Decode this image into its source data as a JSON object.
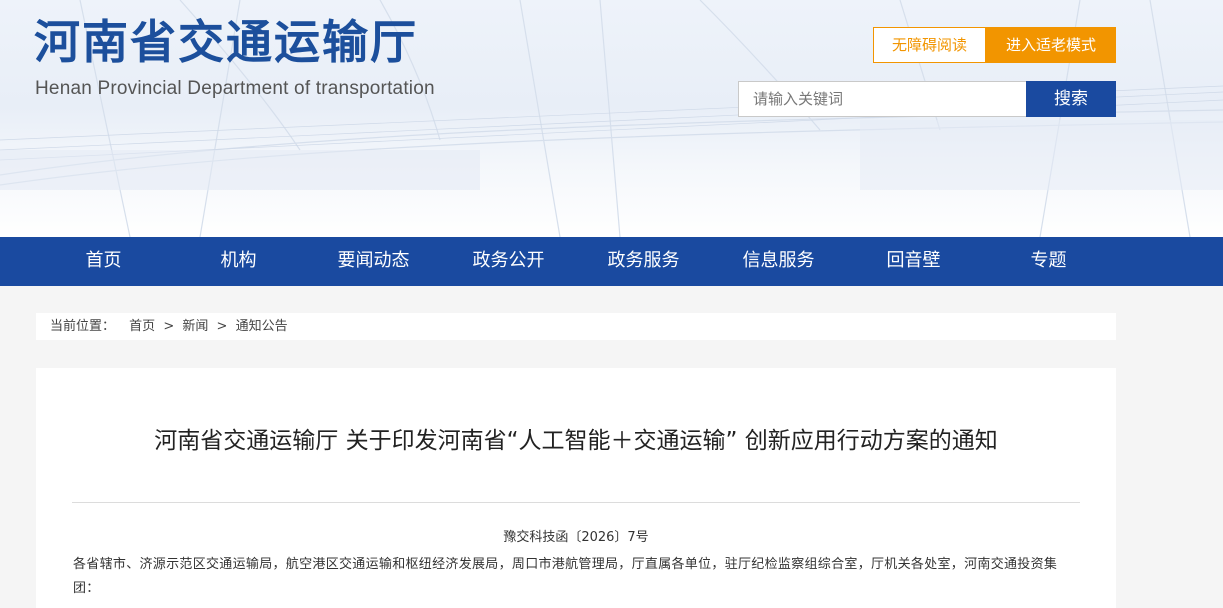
{
  "header": {
    "logo_cn": "河南省交通运输厅",
    "logo_en": "Henan Provincial Department of transportation",
    "accessible_read": "无障碍阅读",
    "elder_mode": "进入适老模式",
    "search": {
      "placeholder": "请输入关键词",
      "button": "搜索"
    }
  },
  "nav": {
    "items": [
      {
        "label": "首页"
      },
      {
        "label": "机构"
      },
      {
        "label": "要闻动态"
      },
      {
        "label": "政务公开"
      },
      {
        "label": "政务服务"
      },
      {
        "label": "信息服务"
      },
      {
        "label": "回音壁"
      },
      {
        "label": "专题"
      }
    ]
  },
  "breadcrumb": {
    "label": "当前位置：",
    "items": [
      "首页",
      "新闻",
      "通知公告"
    ],
    "separator": ">"
  },
  "article": {
    "title": "河南省交通运输厅 关于印发河南省“人工智能＋交通运输” 创新应用行动方案的通知",
    "doc_number": "豫交科技函〔2026〕7号",
    "body": "各省辖市、济源示范区交通运输局，航空港区交通运输和枢纽经济发展局，周口市港航管理局，厅直属各单位，驻厅纪检监察组综合室，厅机关各处室，河南交通投资集团："
  },
  "colors": {
    "primary_blue": "#1a4aa0",
    "accent_orange": "#f29500",
    "logo_blue": "#1c4f9c"
  }
}
